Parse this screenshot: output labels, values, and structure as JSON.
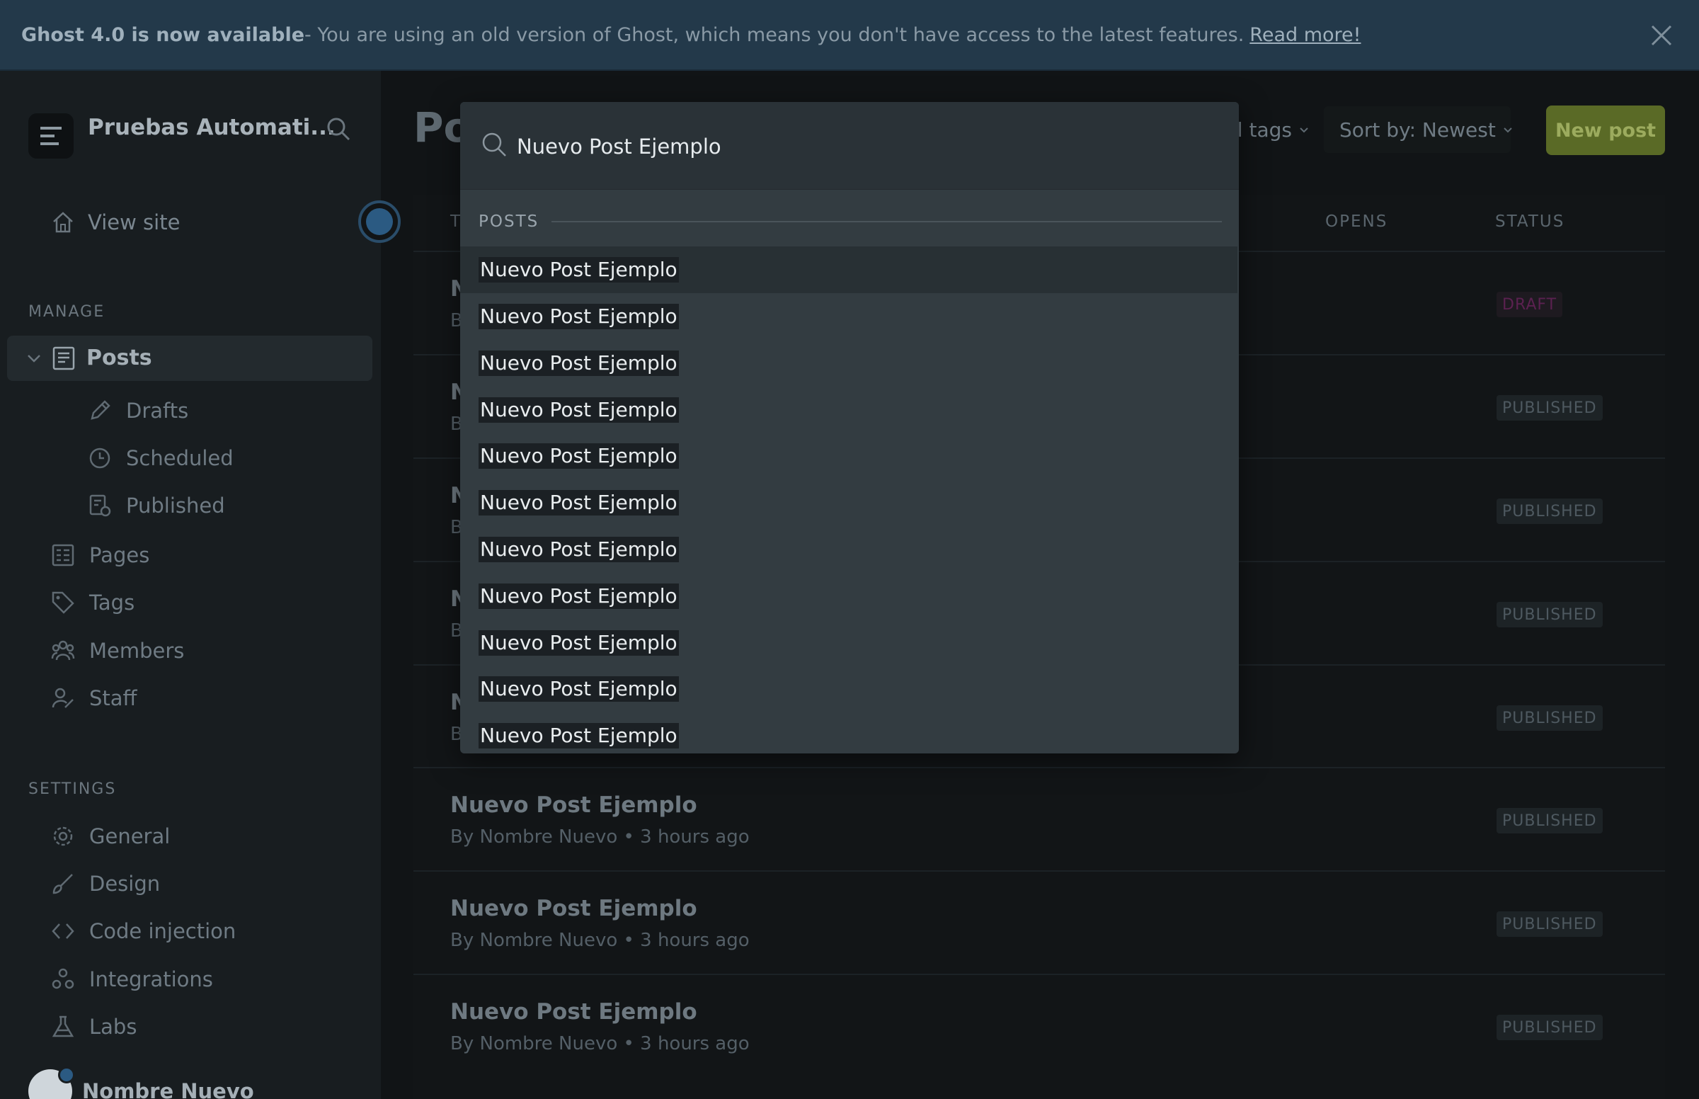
{
  "banner": {
    "title": "Ghost 4.0 is now available",
    "message": " - You are using an old version of Ghost, which means you don't have access to the latest features.",
    "link": "Read more!"
  },
  "sidebar": {
    "brand": "Pruebas Automati...",
    "view_site": "View site",
    "manage_label": "MANAGE",
    "posts": "Posts",
    "drafts": "Drafts",
    "scheduled": "Scheduled",
    "published": "Published",
    "pages": "Pages",
    "tags": "Tags",
    "members": "Members",
    "staff": "Staff",
    "settings_label": "SETTINGS",
    "general": "General",
    "design": "Design",
    "code_injection": "Code injection",
    "integrations": "Integrations",
    "labs": "Labs",
    "user_name": "Nombre Nuevo"
  },
  "main": {
    "title": "Po",
    "tags_filter": "ll tags",
    "sort_filter": "Sort by: Newest",
    "new_post": "New post",
    "col_title": "T",
    "col_opens": "OPENS",
    "col_status": "STATUS",
    "rows": [
      {
        "title": "N",
        "meta": "B",
        "status": "DRAFT"
      },
      {
        "title": "N",
        "meta": "B",
        "status": "PUBLISHED"
      },
      {
        "title": "N",
        "meta": "B",
        "status": "PUBLISHED"
      },
      {
        "title": "N",
        "meta": "B",
        "status": "PUBLISHED"
      },
      {
        "title": "N",
        "meta": "B",
        "status": "PUBLISHED"
      },
      {
        "title": "Nuevo Post Ejemplo",
        "meta": "By Nombre Nuevo • 3 hours ago",
        "status": "PUBLISHED"
      },
      {
        "title": "Nuevo Post Ejemplo",
        "meta": "By Nombre Nuevo • 3 hours ago",
        "status": "PUBLISHED"
      },
      {
        "title": "Nuevo Post Ejemplo",
        "meta": "By Nombre Nuevo • 3 hours ago",
        "status": "PUBLISHED"
      }
    ]
  },
  "search": {
    "query": "Nuevo Post Ejemplo",
    "section": "POSTS",
    "results": [
      "Nuevo Post Ejemplo",
      "Nuevo Post Ejemplo",
      "Nuevo Post Ejemplo",
      "Nuevo Post Ejemplo",
      "Nuevo Post Ejemplo",
      "Nuevo Post Ejemplo",
      "Nuevo Post Ejemplo",
      "Nuevo Post Ejemplo",
      "Nuevo Post Ejemplo",
      "Nuevo Post Ejemplo",
      "Nuevo Post Ejemplo"
    ]
  },
  "colors": {
    "banner_bg": "#23394a",
    "sidebar_bg": "#181d20",
    "accent_blue": "#2b5a82",
    "new_post_green": "#5a6a26",
    "draft_pink": "#5b2150"
  }
}
